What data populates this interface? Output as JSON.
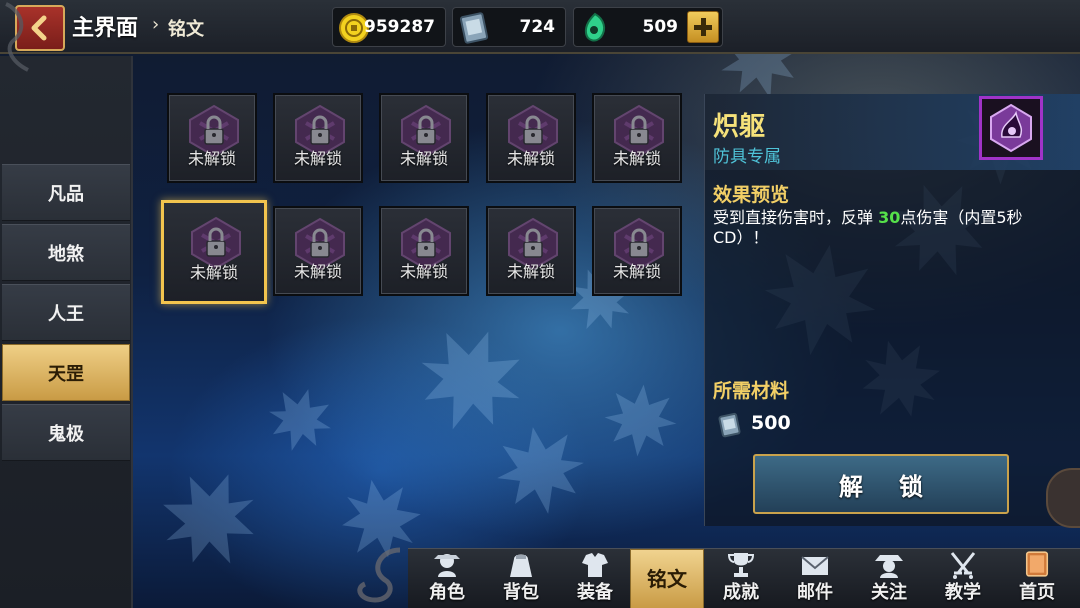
{
  "header": {
    "title": "主界面",
    "separator": "›",
    "subtitle": "铭文"
  },
  "resources": [
    {
      "name": "gold",
      "icon": "gold-coin-icon",
      "value": "959287"
    },
    {
      "name": "inscription-book",
      "icon": "book-icon",
      "value": "724"
    },
    {
      "name": "jade",
      "icon": "jade-icon",
      "value": "509"
    }
  ],
  "sidebar": {
    "tabs": [
      {
        "label": "凡品",
        "active": false
      },
      {
        "label": "地煞",
        "active": false
      },
      {
        "label": "人王",
        "active": false
      },
      {
        "label": "天罡",
        "active": true
      },
      {
        "label": "鬼极",
        "active": false
      }
    ]
  },
  "slots": {
    "locked_label": "未解锁",
    "rows": 2,
    "cols": 5,
    "selected_index": 5
  },
  "detail": {
    "name": "炽躯",
    "type": "防具专属",
    "effect_title": "效果预览",
    "effect_text_prefix": "受到直接伤害时，反弹 ",
    "effect_value": "30",
    "effect_text_suffix": "点伤害（内置5秒CD）！",
    "material_title": "所需材料",
    "material_icon": "book-icon",
    "material_amount": "500",
    "unlock_label": "解锁"
  },
  "bottom_nav": [
    {
      "label": "角色",
      "icon": "character-icon",
      "active": false
    },
    {
      "label": "背包",
      "icon": "bag-icon",
      "active": false
    },
    {
      "label": "装备",
      "icon": "armor-icon",
      "active": false
    },
    {
      "label": "铭文",
      "icon": "inscription-icon",
      "active": true
    },
    {
      "label": "成就",
      "icon": "trophy-icon",
      "active": false
    },
    {
      "label": "邮件",
      "icon": "mail-icon",
      "active": false
    },
    {
      "label": "关注",
      "icon": "follow-icon",
      "active": false
    },
    {
      "label": "教学",
      "icon": "swords-icon",
      "active": false
    },
    {
      "label": "首页",
      "icon": "home-icon",
      "active": false
    }
  ],
  "colors": {
    "accent_gold": "#f2c44e",
    "name_yellow": "#f6e27a",
    "type_cyan": "#4fc3d8",
    "highlight_green": "#55e04a",
    "rarity_purple": "#a033c8"
  }
}
